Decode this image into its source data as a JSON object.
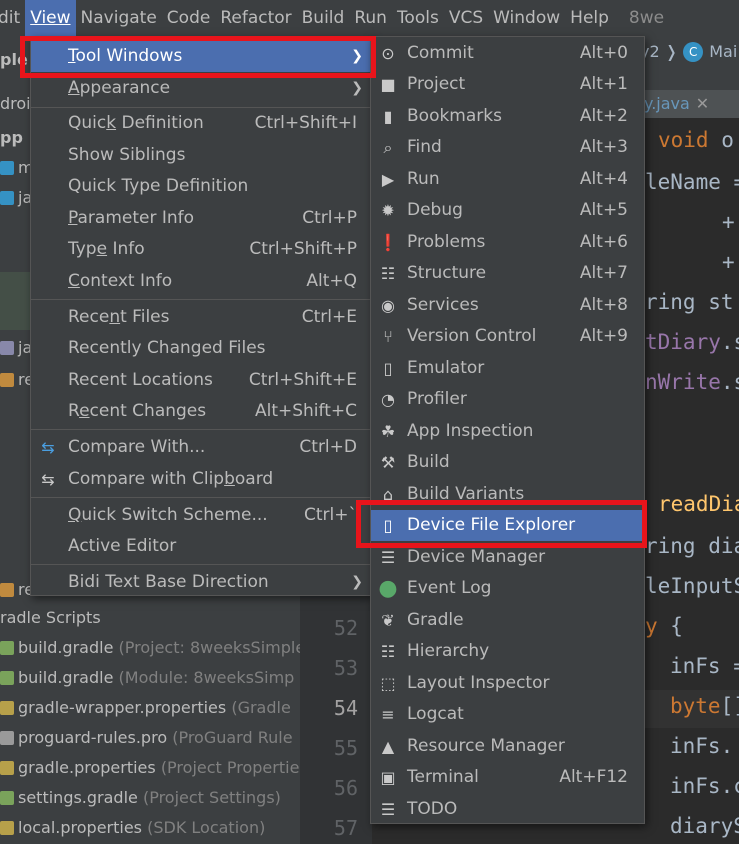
{
  "menubar": {
    "items": [
      "dit",
      "View",
      "Navigate",
      "Code",
      "Refactor",
      "Build",
      "Run",
      "Tools",
      "VCS",
      "Window",
      "Help"
    ],
    "extra": "8we"
  },
  "project_tree": {
    "rows": [
      {
        "label": "ple",
        "hint": ""
      },
      {
        "label": "droic",
        "hint": ""
      },
      {
        "label": "pp",
        "hint": ""
      },
      {
        "label": "m",
        "hint": ""
      },
      {
        "label": "ja",
        "hint": ""
      },
      {
        "label": "ja",
        "hint": ""
      },
      {
        "label": "re",
        "hint": ""
      },
      {
        "label": "re",
        "hint": ""
      },
      {
        "label": "radle Scripts",
        "hint": ""
      },
      {
        "label": "build.gradle",
        "hint": "(Project: 8weeksSimple"
      },
      {
        "label": "build.gradle",
        "hint": "(Module: 8weeksSimp"
      },
      {
        "label": "gradle-wrapper.properties",
        "hint": "(Gradle"
      },
      {
        "label": "proguard-rules.pro",
        "hint": "(ProGuard Rule"
      },
      {
        "label": "gradle.properties",
        "hint": "(Project Propertie"
      },
      {
        "label": "settings.gradle",
        "hint": "(Project Settings)"
      },
      {
        "label": "local.properties",
        "hint": "(SDK Location)"
      }
    ]
  },
  "editor": {
    "breadcrumb": "y2 ❭",
    "breadcrumb_class": "Mai",
    "tab": "y.java",
    "tab_close": "✕",
    "line_numbers": [
      "52",
      "53",
      "54",
      "55",
      "56",
      "57"
    ],
    "current_line": "54"
  },
  "view_menu": {
    "items": [
      {
        "pre": "",
        "u": "T",
        "post": "ool Windows",
        "shortcut": "",
        "submenu": true,
        "icon": ""
      },
      {
        "pre": "",
        "u": "A",
        "post": "ppearance",
        "shortcut": "",
        "submenu": true,
        "icon": ""
      },
      {
        "pre": "Quic",
        "u": "k",
        "post": " Definition",
        "shortcut": "Ctrl+Shift+I",
        "submenu": false,
        "icon": ""
      },
      {
        "pre": "Show Siblings",
        "u": "",
        "post": "",
        "shortcut": "",
        "submenu": false,
        "icon": ""
      },
      {
        "pre": "Quick Type Definition",
        "u": "",
        "post": "",
        "shortcut": "",
        "submenu": false,
        "icon": ""
      },
      {
        "pre": "",
        "u": "P",
        "post": "arameter Info",
        "shortcut": "Ctrl+P",
        "submenu": false,
        "icon": ""
      },
      {
        "pre": "Typ",
        "u": "e",
        "post": " Info",
        "shortcut": "Ctrl+Shift+P",
        "submenu": false,
        "icon": ""
      },
      {
        "pre": "",
        "u": "C",
        "post": "ontext Info",
        "shortcut": "Alt+Q",
        "submenu": false,
        "icon": ""
      },
      {
        "pre": "Rece",
        "u": "n",
        "post": "t Files",
        "shortcut": "Ctrl+E",
        "submenu": false,
        "icon": ""
      },
      {
        "pre": "Recently Changed Files",
        "u": "",
        "post": "",
        "shortcut": "",
        "submenu": false,
        "icon": ""
      },
      {
        "pre": "Recent Locations",
        "u": "",
        "post": "",
        "shortcut": "Ctrl+Shift+E",
        "submenu": false,
        "icon": ""
      },
      {
        "pre": "R",
        "u": "e",
        "post": "cent Changes",
        "shortcut": "Alt+Shift+C",
        "submenu": false,
        "icon": ""
      },
      {
        "pre": "Compare With...",
        "u": "",
        "post": "",
        "shortcut": "Ctrl+D",
        "submenu": false,
        "icon": "compare-icon"
      },
      {
        "pre": "Compare with Clip",
        "u": "b",
        "post": "oard",
        "shortcut": "",
        "submenu": false,
        "icon": "compare-clipboard-icon"
      },
      {
        "pre": "",
        "u": "Q",
        "post": "uick Switch Scheme...",
        "shortcut": "Ctrl+`",
        "submenu": false,
        "icon": ""
      },
      {
        "pre": "Active Editor",
        "u": "",
        "post": "",
        "shortcut": "",
        "submenu": false,
        "icon": ""
      },
      {
        "pre": "Bidi Text Base Direction",
        "u": "",
        "post": "",
        "shortcut": "",
        "submenu": true,
        "icon": ""
      }
    ]
  },
  "tool_windows_menu": {
    "items": [
      {
        "label": "Commit",
        "shortcut": "Alt+0",
        "icon": "commit-icon",
        "glyph": "⊙"
      },
      {
        "label": "Project",
        "shortcut": "Alt+1",
        "icon": "folder-icon",
        "glyph": "■"
      },
      {
        "label": "Bookmarks",
        "shortcut": "Alt+2",
        "icon": "bookmark-icon",
        "glyph": "▮"
      },
      {
        "label": "Find",
        "shortcut": "Alt+3",
        "icon": "search-icon",
        "glyph": "⌕"
      },
      {
        "label": "Run",
        "shortcut": "Alt+4",
        "icon": "run-icon",
        "glyph": "▶"
      },
      {
        "label": "Debug",
        "shortcut": "Alt+5",
        "icon": "debug-icon",
        "glyph": "✹"
      },
      {
        "label": "Problems",
        "shortcut": "Alt+6",
        "icon": "problems-icon",
        "glyph": "❗"
      },
      {
        "label": "Structure",
        "shortcut": "Alt+7",
        "icon": "structure-icon",
        "glyph": "☷"
      },
      {
        "label": "Services",
        "shortcut": "Alt+8",
        "icon": "services-icon",
        "glyph": "◉"
      },
      {
        "label": "Version Control",
        "shortcut": "Alt+9",
        "icon": "version-control-icon",
        "glyph": "⑂"
      },
      {
        "label": "Emulator",
        "shortcut": "",
        "icon": "emulator-icon",
        "glyph": "▯"
      },
      {
        "label": "Profiler",
        "shortcut": "",
        "icon": "profiler-icon",
        "glyph": "◔"
      },
      {
        "label": "App Inspection",
        "shortcut": "",
        "icon": "app-inspection-icon",
        "glyph": "☘"
      },
      {
        "label": "Build",
        "shortcut": "",
        "icon": "hammer-icon",
        "glyph": "⚒"
      },
      {
        "label": "Build Variants",
        "shortcut": "",
        "icon": "build-variants-icon",
        "glyph": "⌂"
      },
      {
        "label": "Device File Explorer",
        "shortcut": "",
        "icon": "device-icon",
        "glyph": "▯"
      },
      {
        "label": "Device Manager",
        "shortcut": "",
        "icon": "device-manager-icon",
        "glyph": "☰"
      },
      {
        "label": "Event Log",
        "shortcut": "",
        "icon": "event-log-icon",
        "glyph": "●"
      },
      {
        "label": "Gradle",
        "shortcut": "",
        "icon": "gradle-icon",
        "glyph": "❦"
      },
      {
        "label": "Hierarchy",
        "shortcut": "",
        "icon": "hierarchy-icon",
        "glyph": "☷"
      },
      {
        "label": "Layout Inspector",
        "shortcut": "",
        "icon": "layout-inspector-icon",
        "glyph": "⬚"
      },
      {
        "label": "Logcat",
        "shortcut": "",
        "icon": "logcat-icon",
        "glyph": "≡"
      },
      {
        "label": "Resource Manager",
        "shortcut": "",
        "icon": "resource-manager-icon",
        "glyph": "▲"
      },
      {
        "label": "Terminal",
        "shortcut": "Alt+F12",
        "icon": "terminal-icon",
        "glyph": "▣"
      },
      {
        "label": "TODO",
        "shortcut": "",
        "icon": "todo-icon",
        "glyph": "☰"
      }
    ]
  },
  "colors": {
    "highlight": "#4b6eaf",
    "menu_bg": "#3c3f41",
    "annotation_red": "#e8141b"
  }
}
